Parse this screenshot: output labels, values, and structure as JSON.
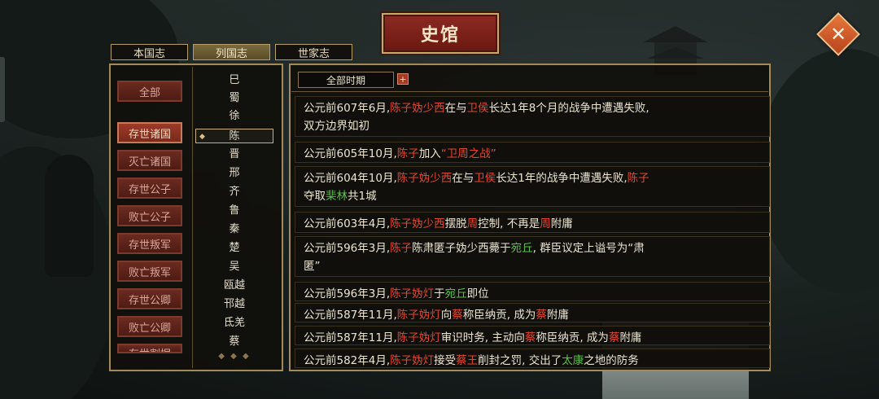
{
  "title": "史馆",
  "tabs": [
    {
      "label": "本国志",
      "active": false
    },
    {
      "label": "列国志",
      "active": true
    },
    {
      "label": "世家志",
      "active": false
    }
  ],
  "categories": [
    {
      "label": "全部",
      "selected": false
    },
    {
      "label": "存世诸国",
      "selected": true
    },
    {
      "label": "灭亡诸国",
      "selected": false
    },
    {
      "label": "存世公子",
      "selected": false
    },
    {
      "label": "败亡公子",
      "selected": false
    },
    {
      "label": "存世叛军",
      "selected": false
    },
    {
      "label": "败亡叛军",
      "selected": false
    },
    {
      "label": "存世公卿",
      "selected": false
    },
    {
      "label": "败亡公卿",
      "selected": false
    },
    {
      "label": "存世割据",
      "selected": false
    }
  ],
  "countries": [
    "巳",
    "蜀",
    "徐",
    "陈",
    "晋",
    "邢",
    "齐",
    "鲁",
    "秦",
    "楚",
    "吴",
    "瓯越",
    "邗越",
    "氐羌",
    "蔡"
  ],
  "selected_country": "陈",
  "filter": {
    "label": "全部时期",
    "plus": "+"
  },
  "records": [
    {
      "parts": [
        [
          "公元前607年6月,",
          ""
        ],
        [
          "陈子妫少西",
          "r"
        ],
        [
          "在与",
          ""
        ],
        [
          "卫侯",
          "r"
        ],
        [
          "长达1年8个月的战争中遭遇失败,",
          ""
        ]
      ],
      "line2": [
        [
          "双方边界如初",
          ""
        ]
      ]
    },
    {
      "parts": [
        [
          "公元前605年10月,",
          ""
        ],
        [
          "陈子",
          "r"
        ],
        [
          "加入",
          ""
        ],
        [
          "“卫周之战”",
          "r"
        ]
      ]
    },
    {
      "parts": [
        [
          "公元前604年10月,",
          ""
        ],
        [
          "陈子妫少西",
          "r"
        ],
        [
          "在与",
          ""
        ],
        [
          "卫侯",
          "r"
        ],
        [
          "长达1年的战争中遭遇失败,",
          ""
        ],
        [
          "陈子",
          "r"
        ]
      ],
      "line2": [
        [
          "夺取",
          ""
        ],
        [
          "棐林",
          "g"
        ],
        [
          "共1城",
          ""
        ]
      ]
    },
    {
      "parts": [
        [
          "公元前603年4月,",
          ""
        ],
        [
          "陈子妫少西",
          "r"
        ],
        [
          "摆脱",
          ""
        ],
        [
          "周",
          "r"
        ],
        [
          "控制, 不再是",
          ""
        ],
        [
          "周",
          "r"
        ],
        [
          "附庸",
          ""
        ]
      ]
    },
    {
      "parts": [
        [
          "公元前596年3月,",
          ""
        ],
        [
          "陈子",
          "r"
        ],
        [
          "陈肃匿子妫少西薨于",
          ""
        ],
        [
          "宛丘",
          "g"
        ],
        [
          ", 群臣议定上谥号为“肃",
          ""
        ]
      ],
      "line2": [
        [
          "匿”",
          ""
        ]
      ]
    },
    {
      "parts": [
        [
          "公元前596年3月,",
          ""
        ],
        [
          "陈子妫灯",
          "r"
        ],
        [
          "于",
          ""
        ],
        [
          "宛丘",
          "g"
        ],
        [
          "即位",
          ""
        ]
      ]
    },
    {
      "parts": [
        [
          "公元前587年11月,",
          ""
        ],
        [
          "陈子妫灯",
          "r"
        ],
        [
          "向",
          ""
        ],
        [
          "蔡",
          "r"
        ],
        [
          "称臣纳贡, 成为",
          ""
        ],
        [
          "蔡",
          "r"
        ],
        [
          "附庸",
          ""
        ]
      ]
    },
    {
      "parts": [
        [
          "公元前587年11月,",
          ""
        ],
        [
          "陈子妫灯",
          "r"
        ],
        [
          "审识时务, 主动向",
          ""
        ],
        [
          "蔡",
          "r"
        ],
        [
          "称臣纳贡, 成为",
          ""
        ],
        [
          "蔡",
          "r"
        ],
        [
          "附庸",
          ""
        ]
      ]
    },
    {
      "parts": [
        [
          "公元前582年4月,",
          ""
        ],
        [
          "陈子妫灯",
          "r"
        ],
        [
          "接受",
          ""
        ],
        [
          "蔡王",
          "r"
        ],
        [
          "削封之罚, 交出了",
          ""
        ],
        [
          "太康",
          "g"
        ],
        [
          "之地的防务",
          ""
        ]
      ]
    }
  ]
}
